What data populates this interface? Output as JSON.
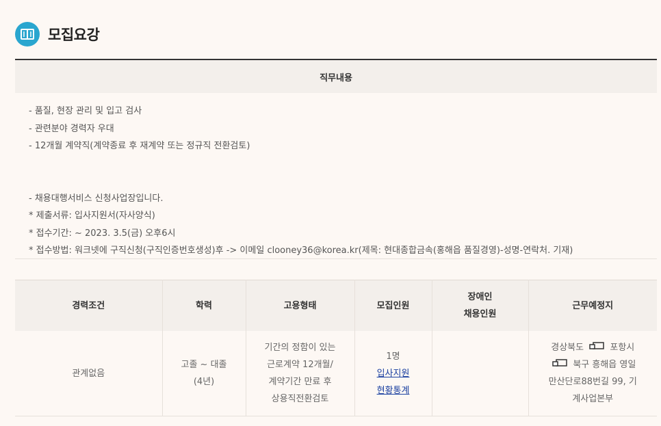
{
  "section": {
    "title": "모집요강",
    "icon": "book-icon"
  },
  "job": {
    "header": "직무내용",
    "lines": [
      "- 품질, 현장 관리 및 입고 검사",
      "- 관련분야 경력자 우대",
      "- 12개월 계약직(계약종료 후 재계약 또는 정규직 전환검토)"
    ],
    "lines2": [
      "- 채용대행서비스 신청사업장입니다.",
      "* 제출서류: 입사지원서(자사양식)",
      "* 접수기간:    ~    2023. 3.5(금) 오후6시",
      "* 접수방법: 워크넷에 구직신청(구직인증번호생성)후   ->  이메일 clooney36@korea.kr(제목: 현대종합금속(홍해읍 품질경영)-성명-연락처. 기재)"
    ]
  },
  "table": {
    "headers": {
      "career": "경력조건",
      "education": "학력",
      "employment": "고용형태",
      "recruits": "모집인원",
      "disabled_1": "장애인",
      "disabled_2": "채용인원",
      "location": "근무예정지"
    },
    "row": {
      "career": "관계없음",
      "education_1": "고졸 ~ 대졸",
      "education_2": "(4년)",
      "employment_1": "기간의 정함이 있는",
      "employment_2": "근로계약 12개월/",
      "employment_3": "계약기간 만료 후",
      "employment_4": "상용직전환검토",
      "recruits": "1명",
      "apply_link": "입사지원",
      "stats_link": "현황통계",
      "disabled": "",
      "location_1a": "경상북도",
      "location_1b": "포항시",
      "location_2": "북구 흥해읍 영일",
      "location_3": "만산단로88번길 99, 기",
      "location_4": "계사업본부"
    }
  }
}
